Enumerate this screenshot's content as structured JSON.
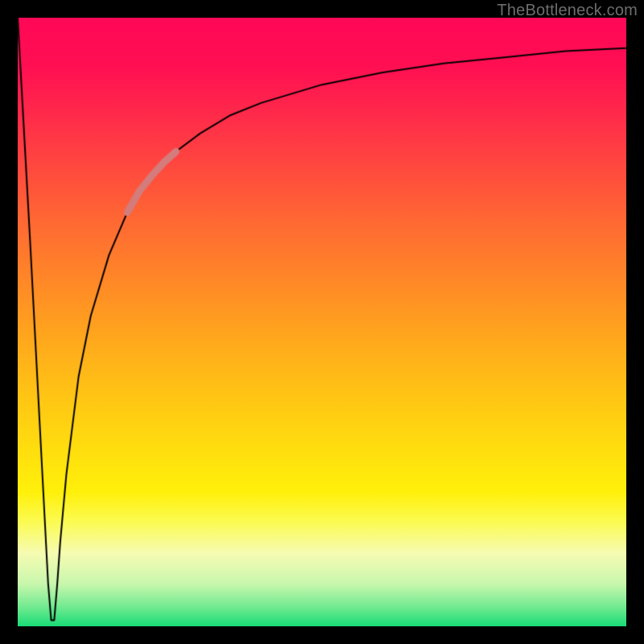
{
  "watermark": "TheBottleneck.com",
  "chart_data": {
    "type": "line",
    "title": "",
    "xlabel": "",
    "ylabel": "",
    "xlim": [
      0,
      100
    ],
    "ylim": [
      0,
      100
    ],
    "grid": false,
    "legend": false,
    "background_gradient": {
      "direction": "vertical",
      "stops": [
        {
          "pos": 0,
          "color": "#ff0757"
        },
        {
          "pos": 25,
          "color": "#ff4a3e"
        },
        {
          "pos": 55,
          "color": "#ffb418"
        },
        {
          "pos": 78,
          "color": "#fff00a"
        },
        {
          "pos": 100,
          "color": "#18dc76"
        }
      ]
    },
    "series": [
      {
        "name": "bottleneck-curve",
        "color": "#000000",
        "width": 2,
        "x": [
          0,
          2,
          4,
          5,
          5.5,
          6,
          6.5,
          7,
          8,
          10,
          12,
          15,
          18,
          22,
          26,
          30,
          35,
          40,
          50,
          60,
          70,
          80,
          90,
          100
        ],
        "values": [
          100,
          64,
          26,
          7,
          1,
          1,
          7,
          14,
          25,
          41,
          51,
          61,
          68,
          74,
          78,
          81,
          84,
          86,
          89,
          91,
          92.5,
          93.5,
          94.5,
          95
        ]
      },
      {
        "name": "highlight-segment",
        "color": "#d47b7b",
        "width": 9,
        "x": [
          18,
          20,
          22,
          24,
          26
        ],
        "values": [
          68,
          71.5,
          74,
          76.2,
          78
        ]
      }
    ]
  }
}
